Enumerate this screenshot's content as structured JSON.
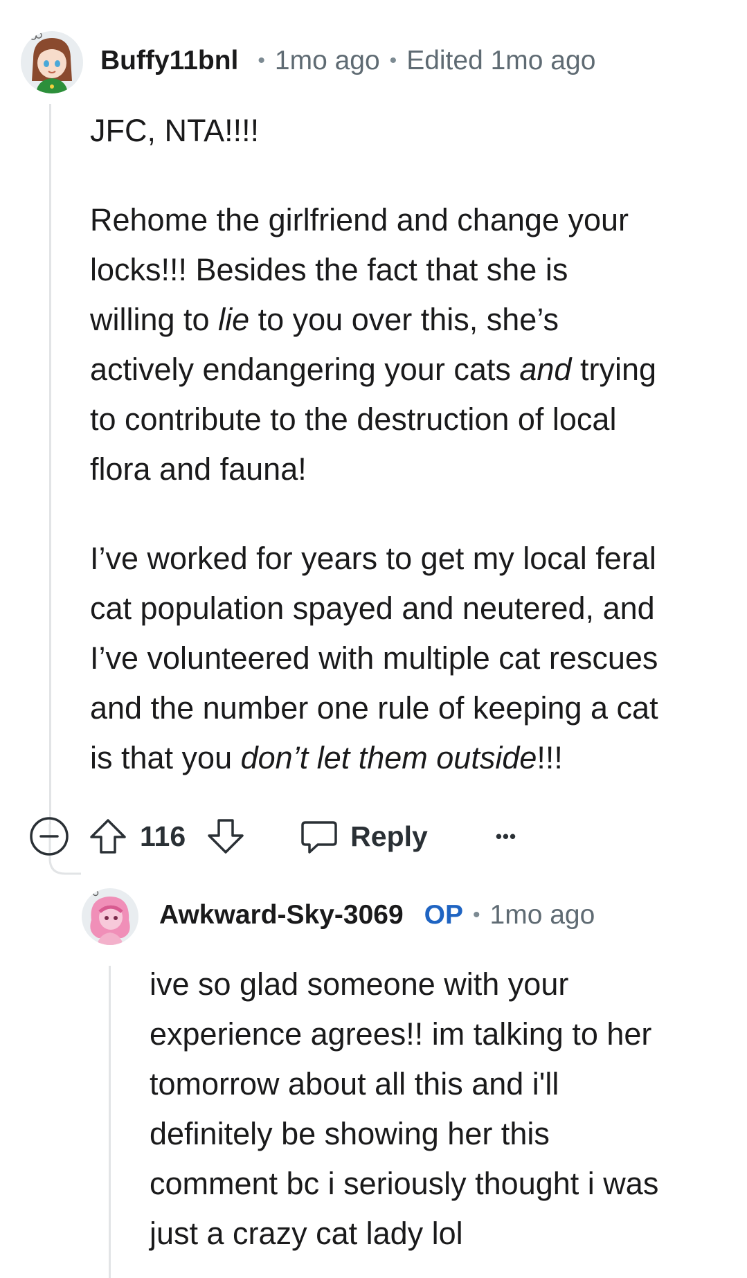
{
  "comment": {
    "username": "Buffy11bnl",
    "age": "1mo ago",
    "edited": "Edited 1mo ago",
    "paragraphs": [
      "JFC, NTA!!!!",
      "Rehome the girlfriend and change your\nlocks!!!  Besides the fact that she is\nwilling to |lie| to you over this, she’s\nactively endangering your cats |and| trying\nto contribute to the destruction of local\nflora and fauna!",
      "I’ve worked for years to get my local feral\ncat population spayed and neutered, and\nI’ve volunteered with multiple cat rescues\nand the number one rule of keeping a cat\nis that you |don’t let them outside|!!!"
    ],
    "vote_count": "116",
    "reply_label": "Reply",
    "more_label": "•••"
  },
  "reply": {
    "username": "Awkward-Sky-3069",
    "op_badge": "OP",
    "age": "1mo ago",
    "paragraphs": [
      "ive so glad someone with your\nexperience agrees!! im talking to her\ntomorrow about all this and i'll\ndefinitely be showing her this\ncomment bc i seriously thought i was\njust a crazy cat lady lol"
    ]
  },
  "colors": {
    "username": "#1a1a1b",
    "muted": "#5f6b73",
    "op_badge": "#1f64c2",
    "thread_line": "#e2e4e6"
  },
  "icons": {
    "collapse": "collapse-icon",
    "upvote": "upvote-arrow-icon",
    "downvote": "downvote-arrow-icon",
    "reply": "speech-bubble-icon",
    "more": "more-options-icon"
  }
}
